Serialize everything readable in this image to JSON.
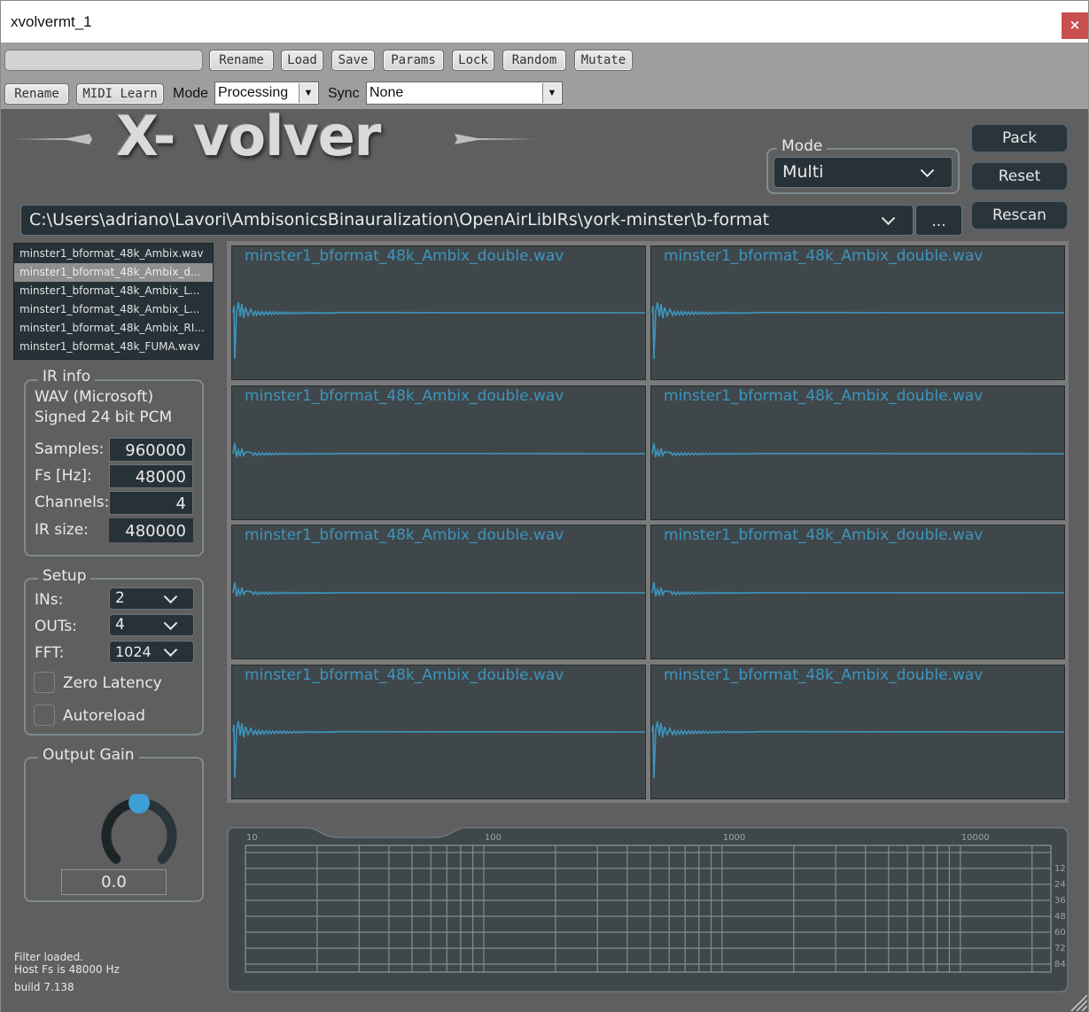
{
  "window": {
    "title": "xvolvermt_1",
    "close_label": "×"
  },
  "host_toolbar": {
    "preset_name": "",
    "row1_buttons": [
      "Rename",
      "Load",
      "Save",
      "Params",
      "Lock",
      "Random",
      "Mutate"
    ],
    "rename_label": "Rename",
    "midi_learn_label": "MIDI Learn",
    "mode_label": "Mode",
    "mode_value": "Processing",
    "sync_label": "Sync",
    "sync_value": "None"
  },
  "plugin": {
    "logo_text": "X- volver",
    "mode": {
      "legend": "Mode",
      "value": "Multi"
    },
    "buttons": {
      "pack": "Pack",
      "reset": "Reset",
      "rescan": "Rescan",
      "browse": "..."
    },
    "path": "C:\\Users\\adriano\\Lavori\\AmbisonicsBinauralization\\OpenAirLibIRs\\york-minster\\b-format",
    "files": [
      {
        "name": "minster1_bformat_48k_Ambix.wav",
        "selected": false
      },
      {
        "name": "minster1_bformat_48k_Ambix_d...",
        "selected": true
      },
      {
        "name": "minster1_bformat_48k_Ambix_L...",
        "selected": false
      },
      {
        "name": "minster1_bformat_48k_Ambix_L...",
        "selected": false
      },
      {
        "name": "minster1_bformat_48k_Ambix_RI...",
        "selected": false
      },
      {
        "name": "minster1_bformat_48k_FUMA.wav",
        "selected": false
      }
    ],
    "ir_info": {
      "legend": "IR info",
      "format_line1": "WAV (Microsoft)",
      "format_line2": "Signed 24 bit PCM",
      "samples_label": "Samples:",
      "samples": "960000",
      "fs_label": "Fs [Hz]:",
      "fs": "48000",
      "channels_label": "Channels:",
      "channels": "4",
      "irsize_label": "IR size:",
      "irsize": "480000"
    },
    "setup": {
      "legend": "Setup",
      "ins_label": "INs:",
      "ins": "2",
      "outs_label": "OUTs:",
      "outs": "4",
      "fft_label": "FFT:",
      "fft": "1024",
      "zero_latency_label": "Zero Latency",
      "zero_latency": false,
      "autoreload_label": "Autoreload",
      "autoreload": false
    },
    "output_gain": {
      "legend": "Output Gain",
      "value": "0.0",
      "knob_fraction": 0.5
    },
    "status_line1": "Filter loaded.",
    "status_line2": "Host Fs is 48000 Hz",
    "build": "build 7.138",
    "ir_plots": [
      {
        "title": "minster1_bformat_48k_Ambix_double.wav",
        "variant": "A"
      },
      {
        "title": "minster1_bformat_48k_Ambix_double.wav",
        "variant": "A"
      },
      {
        "title": "minster1_bformat_48k_Ambix_double.wav",
        "variant": "B"
      },
      {
        "title": "minster1_bformat_48k_Ambix_double.wav",
        "variant": "B"
      },
      {
        "title": "minster1_bformat_48k_Ambix_double.wav",
        "variant": "B"
      },
      {
        "title": "minster1_bformat_48k_Ambix_double.wav",
        "variant": "B"
      },
      {
        "title": "minster1_bformat_48k_Ambix_double.wav",
        "variant": "A"
      },
      {
        "title": "minster1_bformat_48k_Ambix_double.wav",
        "variant": "A"
      }
    ],
    "freq_response": {
      "x_ticks": [
        "10",
        "100",
        "1000",
        "10000"
      ],
      "y_ticks": [
        "12",
        "24",
        "36",
        "48",
        "60",
        "72",
        "84"
      ],
      "x_range_hz": [
        10,
        24000
      ],
      "y_range_db": [
        0,
        96
      ]
    }
  },
  "colors": {
    "accent": "#3d95bd",
    "panel_bg": "#5f5f5f",
    "control_bg": "#273138",
    "close_red": "#c94f4f"
  }
}
